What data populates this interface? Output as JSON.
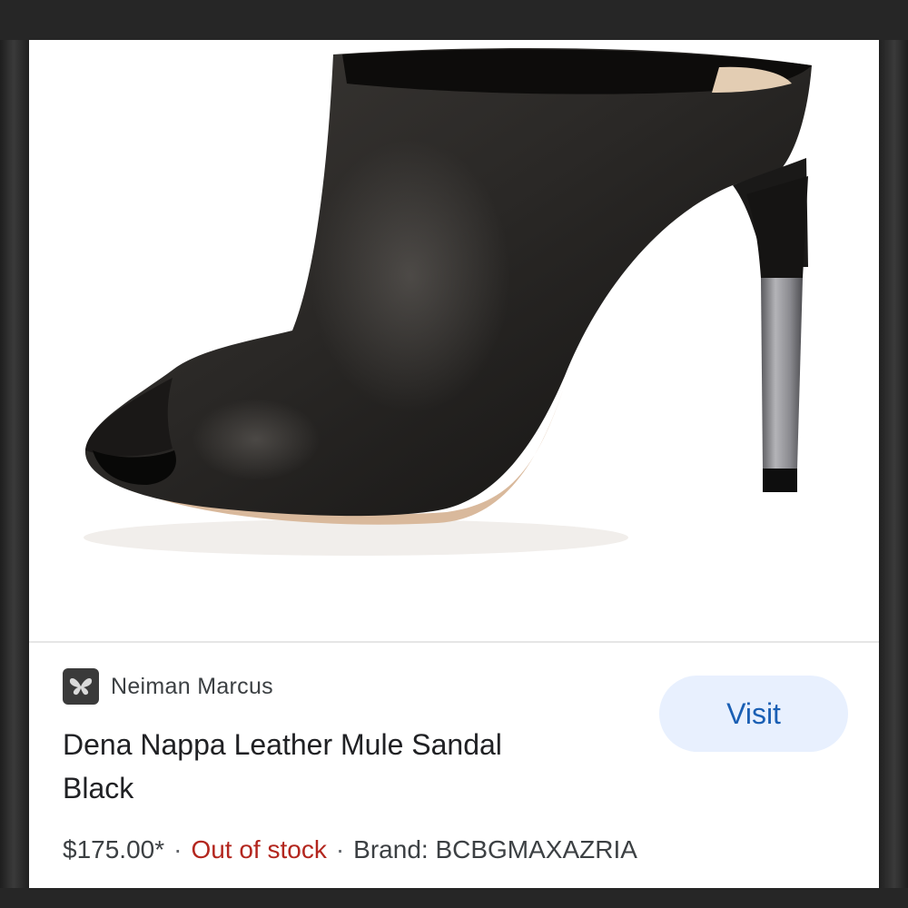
{
  "merchant": {
    "name": "Neiman Marcus",
    "icon": "butterfly-logo-icon"
  },
  "product": {
    "title_line1": "Dena Nappa Leather Mule Sandal",
    "title_line2": "Black",
    "image": "black-leather-peep-toe-mule-with-silver-heel"
  },
  "actions": {
    "visit_label": "Visit"
  },
  "meta": {
    "price": "$175.00*",
    "separator": "·",
    "stock_status": "Out of stock",
    "brand": "Brand: BCBGMAXAZRIA"
  },
  "colors": {
    "stock_status": "#b3261e",
    "visit_button_bg": "#e8f0fe",
    "visit_button_text": "#1a5fb4"
  }
}
